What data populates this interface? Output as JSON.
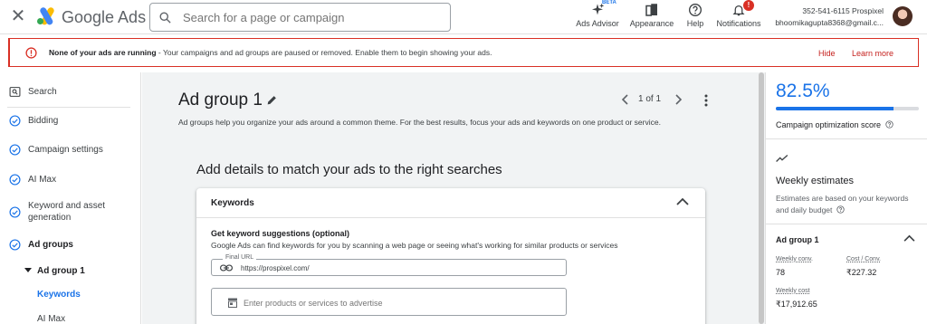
{
  "header": {
    "app_title": "Google Ads",
    "search_placeholder": "Search for a page or campaign",
    "tools": [
      {
        "label": "Ads Advisor",
        "badge": "BETA",
        "icon": "sparkle-icon"
      },
      {
        "label": "Appearance",
        "icon": "appearance-icon"
      },
      {
        "label": "Help",
        "icon": "help-icon"
      },
      {
        "label": "Notifications",
        "badge": "!",
        "icon": "bell-icon"
      }
    ],
    "account_line1": "352-541-6115 Prospixel",
    "account_line2": "bhoomikagupta8368@gmail.c..."
  },
  "banner": {
    "bold": "None of your ads are running",
    "text": " - Your campaigns and ad groups are paused or removed. Enable them to begin showing your ads.",
    "hide": "Hide",
    "learn_more": "Learn more",
    "color": "#d93025"
  },
  "nav": {
    "items": [
      {
        "label": "Search",
        "icon": "search-page-icon"
      },
      {
        "label": "Bidding",
        "icon": "check-circle-icon"
      },
      {
        "label": "Campaign settings",
        "icon": "check-circle-icon"
      },
      {
        "label": "AI Max",
        "icon": "check-circle-icon"
      },
      {
        "label": "Keyword and asset generation",
        "icon": "check-circle-icon"
      },
      {
        "label": "Ad groups",
        "icon": "check-circle-icon"
      }
    ],
    "sub_group": "Ad group 1",
    "sub_items": [
      {
        "label": "Keywords",
        "active": true
      },
      {
        "label": "AI Max",
        "active": false
      }
    ]
  },
  "main": {
    "title": "Ad group 1",
    "pager": "1 of 1",
    "subtitle": "Ad groups help you organize your ads around a common theme. For the best results, focus your ads and keywords on one product or service.",
    "section_heading": "Add details to match your ads to the right searches",
    "card": {
      "title": "Keywords",
      "suggest_title": "Get keyword suggestions (optional)",
      "suggest_desc": "Google Ads can find keywords for you by scanning a web page or seeing what's working for similar products or services",
      "url_label": "Final URL",
      "url_value": "https://prospixel.com/",
      "products_placeholder": "Enter products or services to advertise"
    }
  },
  "right": {
    "score": "82.5%",
    "score_fraction": 0.825,
    "score_label": "Campaign optimization score",
    "weekly_title": "Weekly estimates",
    "weekly_desc": "Estimates are based on your keywords and daily budget",
    "ad_group": "Ad group 1",
    "metrics": {
      "conv_label": "Weekly conv.",
      "conv_value": "78",
      "cost_conv_label": "Cost / Conv.",
      "cost_conv_value": "₹227.32",
      "cost_label": "Weekly cost",
      "cost_value": "₹17,912.65"
    }
  },
  "colors": {
    "accent": "#1a73e8",
    "error": "#d93025",
    "success": "#1a73e8"
  }
}
